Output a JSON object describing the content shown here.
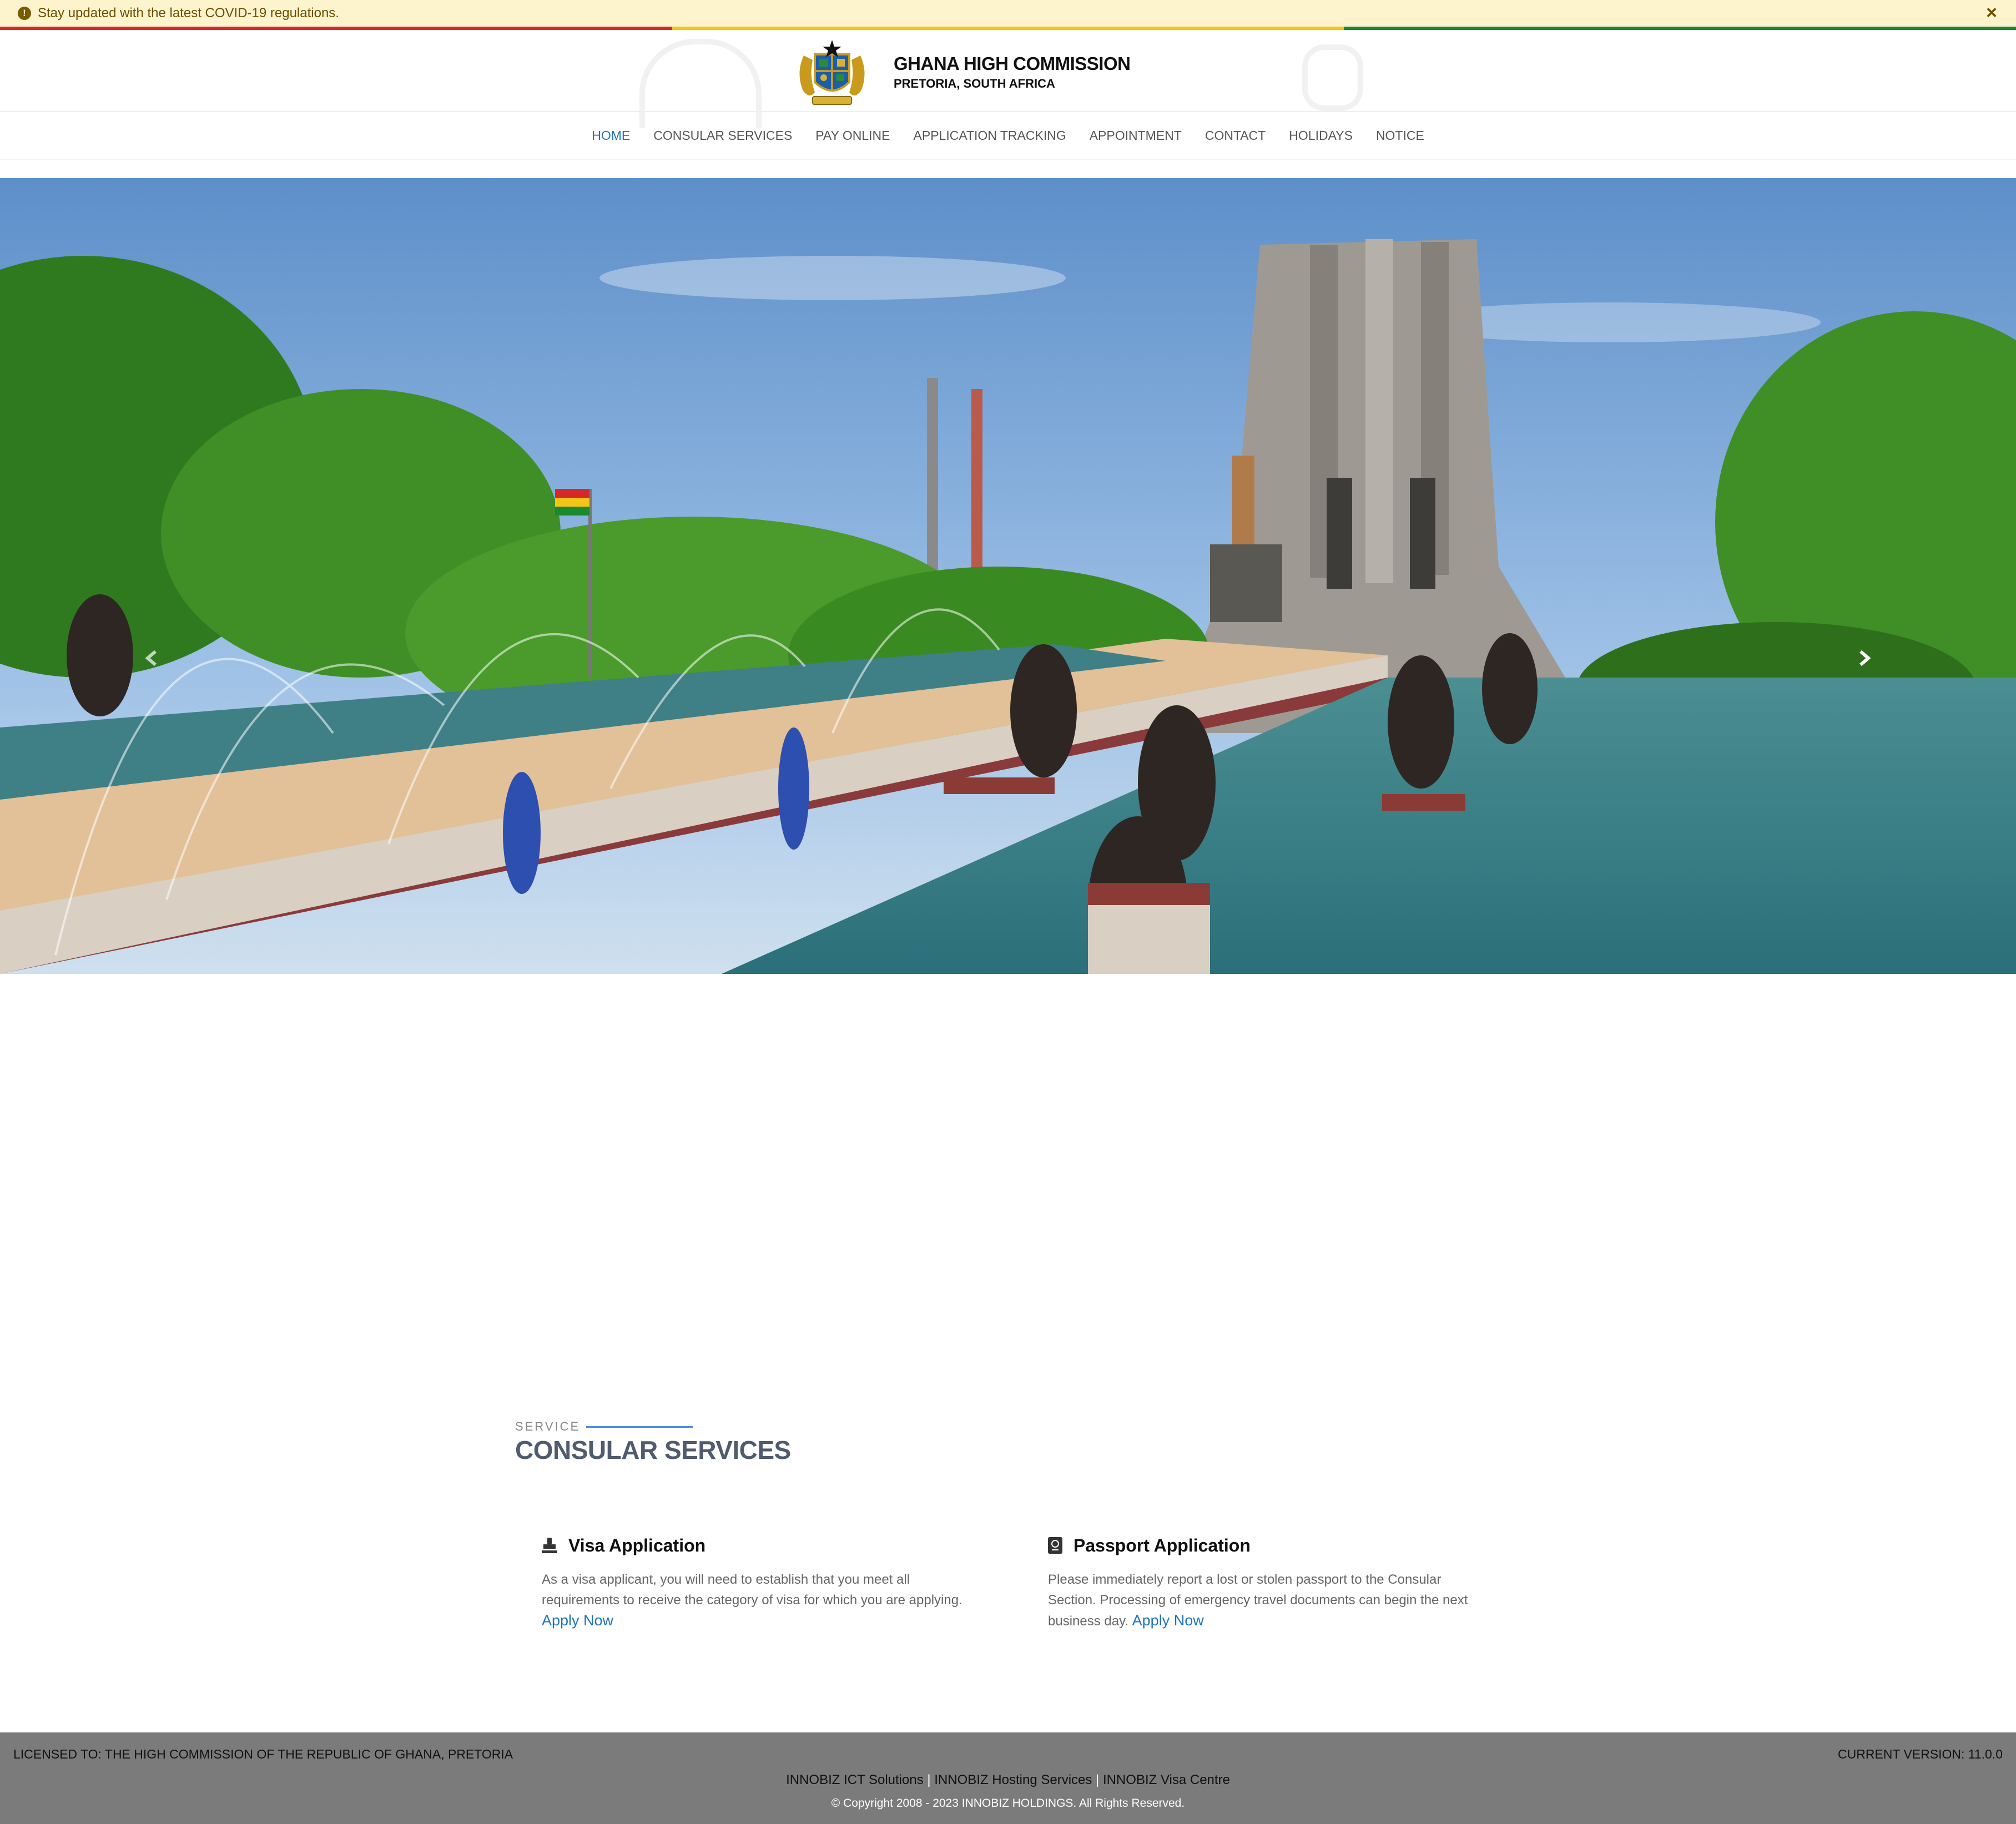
{
  "alert": {
    "message": "Stay updated with the latest COVID-19 regulations.",
    "close_label": "×"
  },
  "flag_colors": [
    "#d72828",
    "#f5c518",
    "#1a8a2f"
  ],
  "brand": {
    "title": "GHANA HIGH COMMISSION",
    "subtitle": "PRETORIA, SOUTH AFRICA"
  },
  "nav": {
    "items": [
      {
        "label": "HOME",
        "active": true
      },
      {
        "label": "CONSULAR SERVICES"
      },
      {
        "label": "PAY ONLINE"
      },
      {
        "label": "APPLICATION TRACKING"
      },
      {
        "label": "APPOINTMENT"
      },
      {
        "label": "CONTACT"
      },
      {
        "label": "HOLIDAYS"
      },
      {
        "label": "NOTICE"
      }
    ],
    "accent": "#1e73be"
  },
  "carousel": {
    "slide_count": 3,
    "active_slide": 1,
    "prev_icon": "chevron-left-icon",
    "next_icon": "chevron-right-icon"
  },
  "services": {
    "label": "SERVICE",
    "title": "CONSULAR SERVICES",
    "cards": [
      {
        "icon": "stamp-icon",
        "title": "Visa Application",
        "text": "As a visa applicant, you will need to establish that you meet all requirements to receive the category of visa for which you are applying.",
        "link": "Apply Now"
      },
      {
        "icon": "passport-icon",
        "title": "Passport Application",
        "text": "Please immediately report a lost or stolen passport to the Consular Section. Processing of emergency travel documents can begin the next business day.",
        "link": "Apply Now"
      }
    ]
  },
  "footer": {
    "licensed": "LICENSED TO: THE HIGH COMMISSION OF THE REPUBLIC OF GHANA, PRETORIA",
    "version": "CURRENT VERSION: 11.0.0",
    "links": [
      "INNOBIZ ICT Solutions",
      "INNOBIZ Hosting Services",
      "INNOBIZ Visa Centre"
    ],
    "copyright": "© Copyright 2008 - 2023 INNOBIZ HOLDINGS. All Rights Reserved."
  }
}
